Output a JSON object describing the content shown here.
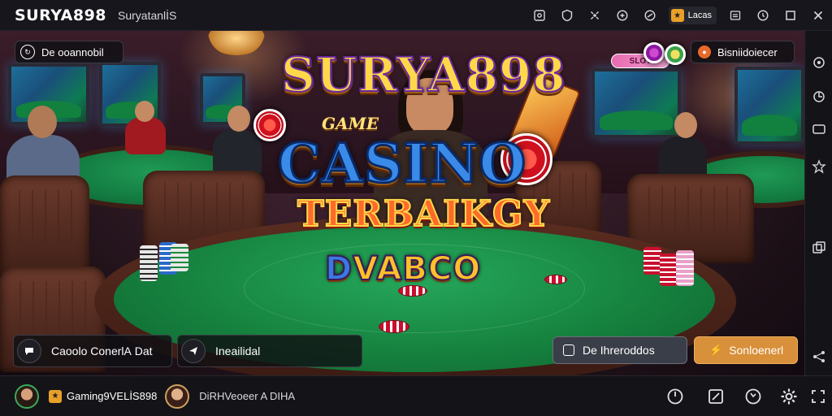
{
  "topbar": {
    "brand": "SURYA898",
    "subtitle": "SuryatanlİS",
    "pill_label": "Lacas",
    "icons": [
      "puzzle-icon",
      "shield-icon",
      "broadcast-icon",
      "gift-icon",
      "swirl-icon",
      "minimize-icon",
      "clock-icon",
      "maximize-icon",
      "close-icon"
    ]
  },
  "scene": {
    "logo_line1": "SURYA898",
    "logo_game": "GAME",
    "logo_line2": "CASINO",
    "logo_line3": "TERBAIKGY",
    "logo_line4_a": "D",
    "logo_line4_b": "VABCO",
    "top_left_button": "De ooannobil",
    "top_right_button": "Bisniidoiecer",
    "top_center_badge": "SLOT"
  },
  "overlay": {
    "left_button_1": "Caoolo ConerlА Dat",
    "left_button_2": "Ineailidal",
    "right_button_1": "De Ihreroddos",
    "right_button_2": "Sonloenerl"
  },
  "bottombar": {
    "gamer_tag": "Gaming9VELİS898",
    "caption": "DiRHVeoeer A DIHA",
    "icons": [
      "speed-icon",
      "broadcast-screen-icon",
      "rotate-icon",
      "settings-icon",
      "fullscreen-icon"
    ]
  },
  "colors": {
    "accent_gold": "#e8a028",
    "felt_green": "#16833f",
    "panel_dark": "#16161c"
  }
}
